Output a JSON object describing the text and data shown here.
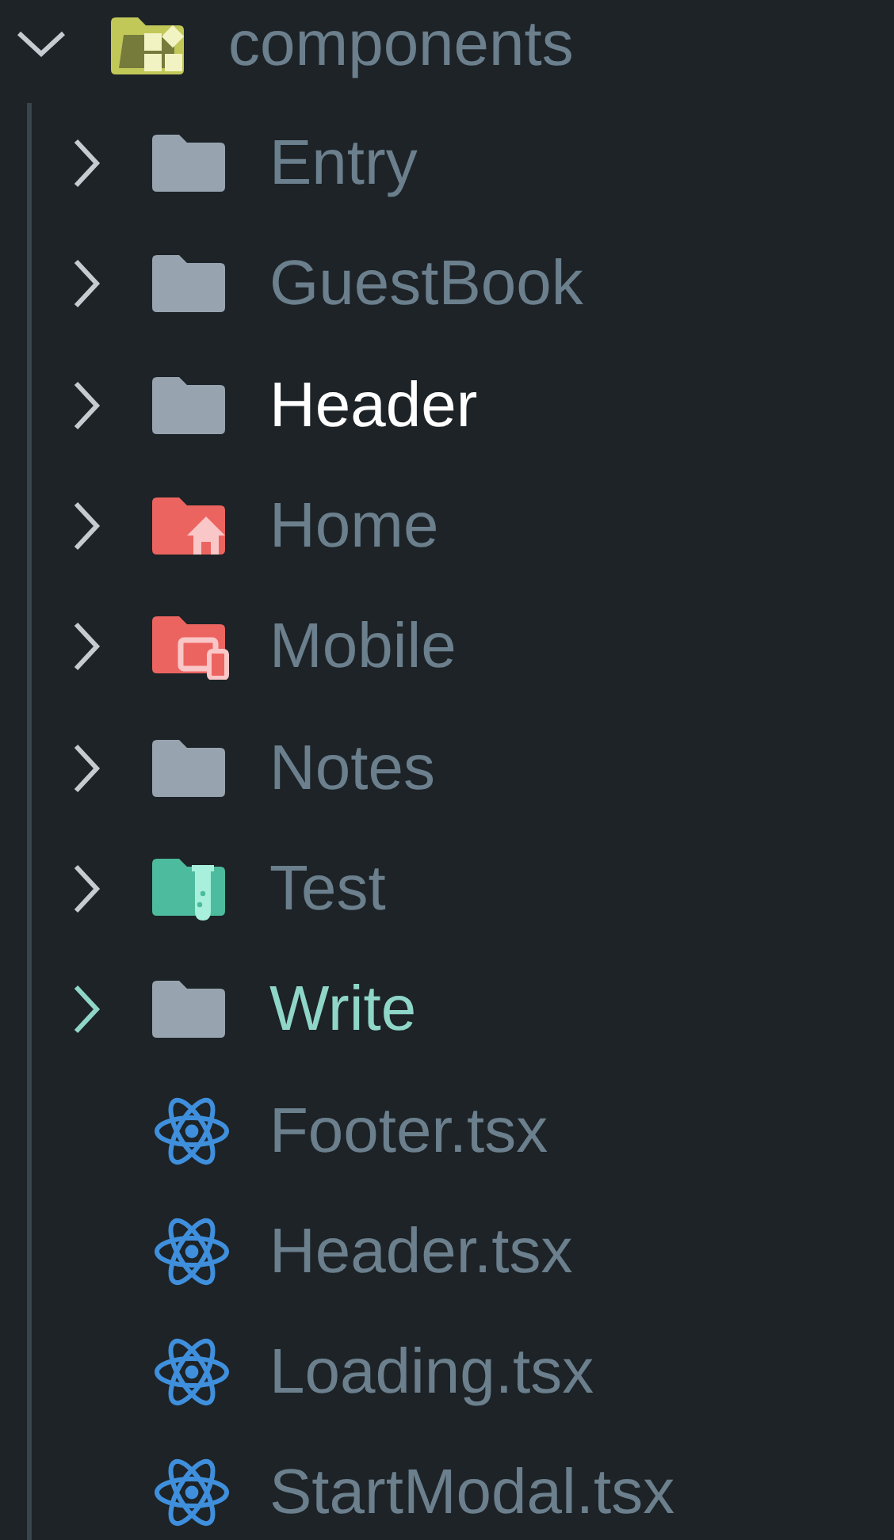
{
  "tree": {
    "name": "components",
    "kind": "components",
    "expanded": true,
    "children": [
      {
        "name": "Entry",
        "kind": "folder",
        "expanded": false,
        "selected": false,
        "modified": false
      },
      {
        "name": "GuestBook",
        "kind": "folder",
        "expanded": false,
        "selected": false,
        "modified": false
      },
      {
        "name": "Header",
        "kind": "folder",
        "expanded": false,
        "selected": true,
        "modified": false
      },
      {
        "name": "Home",
        "kind": "home",
        "expanded": false,
        "selected": false,
        "modified": false
      },
      {
        "name": "Mobile",
        "kind": "devices",
        "expanded": false,
        "selected": false,
        "modified": false
      },
      {
        "name": "Notes",
        "kind": "folder",
        "expanded": false,
        "selected": false,
        "modified": false
      },
      {
        "name": "Test",
        "kind": "test",
        "expanded": false,
        "selected": false,
        "modified": false
      },
      {
        "name": "Write",
        "kind": "folder",
        "expanded": false,
        "selected": false,
        "modified": true
      },
      {
        "name": "Footer.tsx",
        "kind": "react",
        "selected": false,
        "modified": false
      },
      {
        "name": "Header.tsx",
        "kind": "react",
        "selected": false,
        "modified": false
      },
      {
        "name": "Loading.tsx",
        "kind": "react",
        "selected": false,
        "modified": false
      },
      {
        "name": "StartModal.tsx",
        "kind": "react",
        "selected": false,
        "modified": false
      }
    ]
  }
}
